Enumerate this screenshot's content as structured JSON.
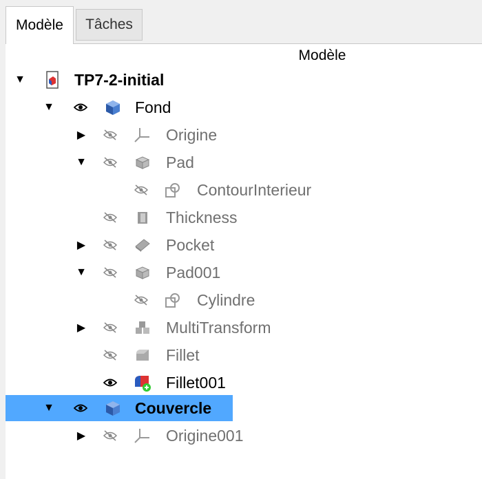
{
  "tabs": {
    "model": "Modèle",
    "tasks": "Tâches"
  },
  "panel": {
    "header": "Modèle"
  },
  "tree": {
    "doc": "TP7-2-initial",
    "fond": "Fond",
    "origine": "Origine",
    "pad": "Pad",
    "contour": "ContourInterieur",
    "thickness": "Thickness",
    "pocket": "Pocket",
    "pad001": "Pad001",
    "cylindre": "Cylindre",
    "multitransform": "MultiTransform",
    "fillet": "Fillet",
    "fillet001": "Fillet001",
    "couvercle": "Couvercle",
    "origine001": "Origine001"
  },
  "colors": {
    "selection": "#3399ff",
    "hidden_text": "#707070"
  }
}
